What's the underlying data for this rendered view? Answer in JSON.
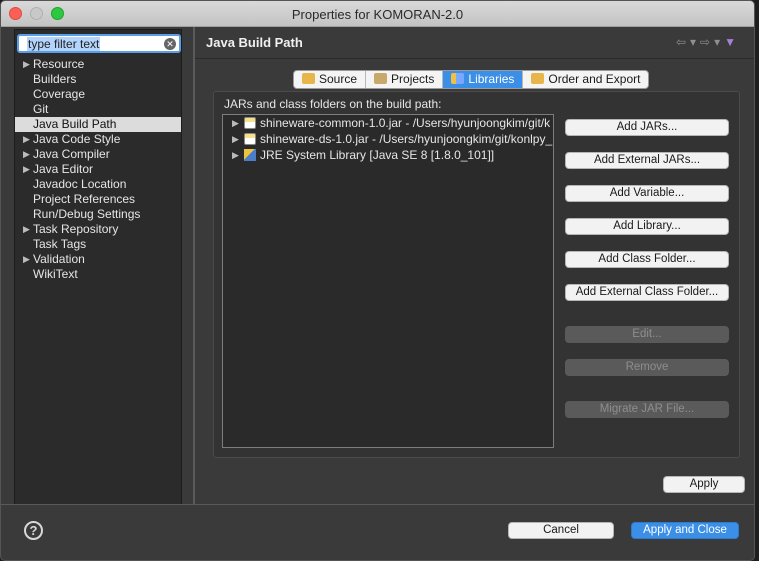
{
  "window": {
    "title": "Properties for KOMORAN-2.0"
  },
  "filter": {
    "placeholder": "type filter text"
  },
  "sidebar": {
    "items": [
      {
        "label": "Resource",
        "expandable": true
      },
      {
        "label": "Builders",
        "expandable": false
      },
      {
        "label": "Coverage",
        "expandable": false
      },
      {
        "label": "Git",
        "expandable": false
      },
      {
        "label": "Java Build Path",
        "expandable": false,
        "selected": true
      },
      {
        "label": "Java Code Style",
        "expandable": true
      },
      {
        "label": "Java Compiler",
        "expandable": true
      },
      {
        "label": "Java Editor",
        "expandable": true
      },
      {
        "label": "Javadoc Location",
        "expandable": false
      },
      {
        "label": "Project References",
        "expandable": false
      },
      {
        "label": "Run/Debug Settings",
        "expandable": false
      },
      {
        "label": "Task Repository",
        "expandable": true
      },
      {
        "label": "Task Tags",
        "expandable": false
      },
      {
        "label": "Validation",
        "expandable": true
      },
      {
        "label": "WikiText",
        "expandable": false
      }
    ]
  },
  "page": {
    "title": "Java Build Path"
  },
  "tabs": [
    {
      "label": "Source",
      "icon": "source-folder-icon"
    },
    {
      "label": "Projects",
      "icon": "projects-icon"
    },
    {
      "label": "Libraries",
      "icon": "libraries-icon",
      "active": true
    },
    {
      "label": "Order and Export",
      "icon": "order-export-icon"
    }
  ],
  "libraries": {
    "heading": "JARs and class folders on the build path:",
    "entries": [
      {
        "label": "shineware-common-1.0.jar - /Users/hyunjoongkim/git/k",
        "icon": "jar-icon"
      },
      {
        "label": "shineware-ds-1.0.jar - /Users/hyunjoongkim/git/konlpy_",
        "icon": "jar-icon"
      },
      {
        "label": "JRE System Library [Java SE 8 [1.8.0_101]]",
        "icon": "library-icon"
      }
    ]
  },
  "buttons": {
    "add_jars": "Add JARs...",
    "add_external_jars": "Add External JARs...",
    "add_variable": "Add Variable...",
    "add_library": "Add Library...",
    "add_class_folder": "Add Class Folder...",
    "add_external_class_folder": "Add External Class Folder...",
    "edit": "Edit...",
    "remove": "Remove",
    "migrate_jar": "Migrate JAR File...",
    "apply": "Apply",
    "cancel": "Cancel",
    "apply_close": "Apply and Close"
  },
  "colors": {
    "accent": "#3c8fe6",
    "background": "#3a3a3a"
  }
}
